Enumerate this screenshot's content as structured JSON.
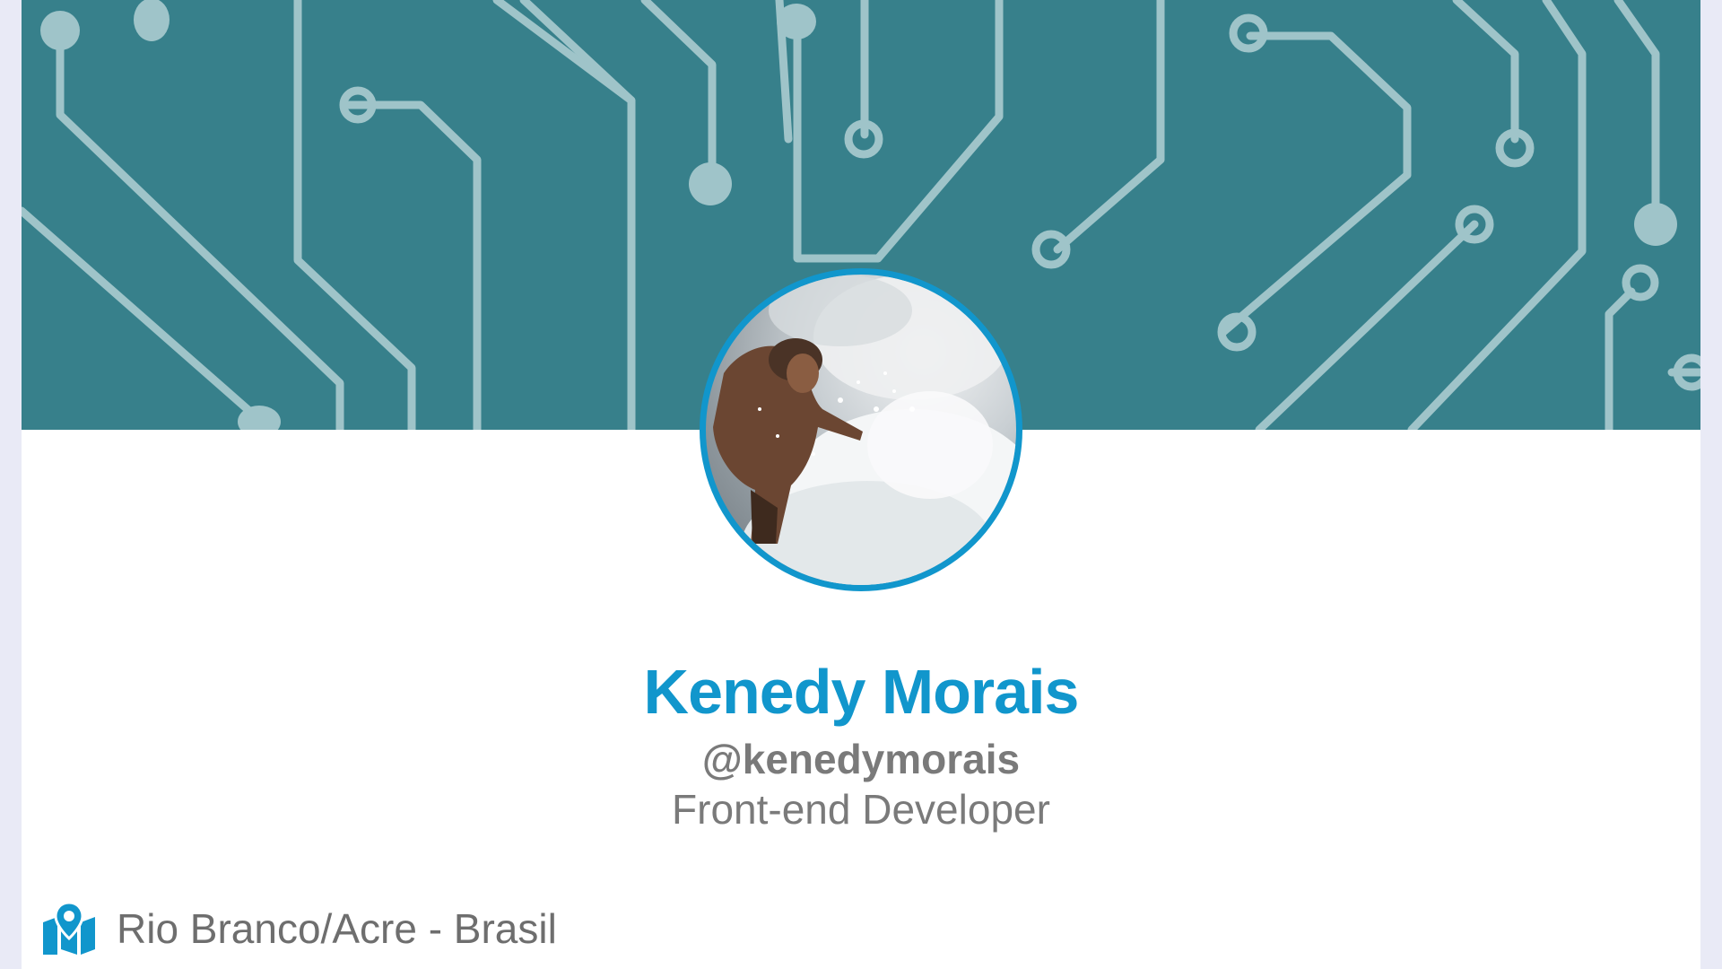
{
  "profile": {
    "name": "Kenedy Morais",
    "handle": "@kenedymorais",
    "role": "Front-end Developer",
    "location": "Rio Branco/Acre - Brasil",
    "location_icon": "map-pin-icon",
    "avatar_alt": "Surfer riding a wave"
  },
  "theme": {
    "banner_color": "#37808b",
    "circuit_color": "#9fc4c9",
    "accent": "#1196cc",
    "text_muted": "#7a7a7a"
  }
}
